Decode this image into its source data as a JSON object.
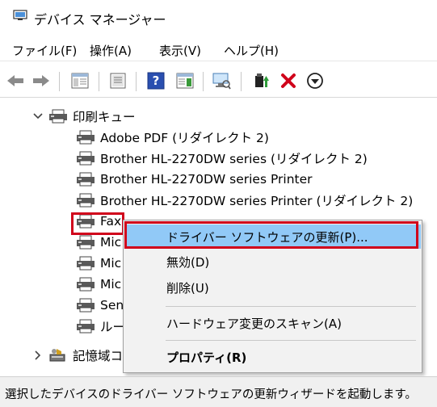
{
  "window": {
    "title": "デバイス マネージャー",
    "icon": "device-manager-icon"
  },
  "menu": [
    "ファイル(F)",
    "操作(A)",
    "表示(V)",
    "ヘルプ(H)"
  ],
  "toolbar": {
    "buttons": [
      "back-arrow-icon",
      "forward-arrow-icon",
      "show-hide-console-tree-icon",
      "properties-icon",
      "help-icon",
      "action-pane-icon",
      "scan-hardware-icon",
      "update-driver-icon",
      "uninstall-icon",
      "download-icon"
    ],
    "colors": {
      "uninstall": "#d0021b",
      "update": "#2e9d3a"
    }
  },
  "tree": {
    "category": "印刷キュー",
    "items": [
      "Adobe PDF (リダイレクト 2)",
      "Brother HL-2270DW series (リダイレクト 2)",
      "Brother HL-2270DW series Printer",
      "Brother HL-2270DW series Printer (リダイレクト 2)",
      "Fax",
      "Mic",
      "Mic",
      "Mic",
      "Sen",
      "ルー"
    ],
    "next_category": "記憶域コ"
  },
  "context_menu": {
    "items": [
      "ドライバー ソフトウェアの更新(P)...",
      "無効(D)",
      "削除(U)",
      "ハードウェア変更のスキャン(A)",
      "プロパティ(R)"
    ],
    "selected_index": 0,
    "highlight_color": "#d0021b",
    "selected_color": "#91c9f7"
  },
  "status": "選択したデバイスのドライバー ソフトウェアの更新ウィザードを起動します。"
}
